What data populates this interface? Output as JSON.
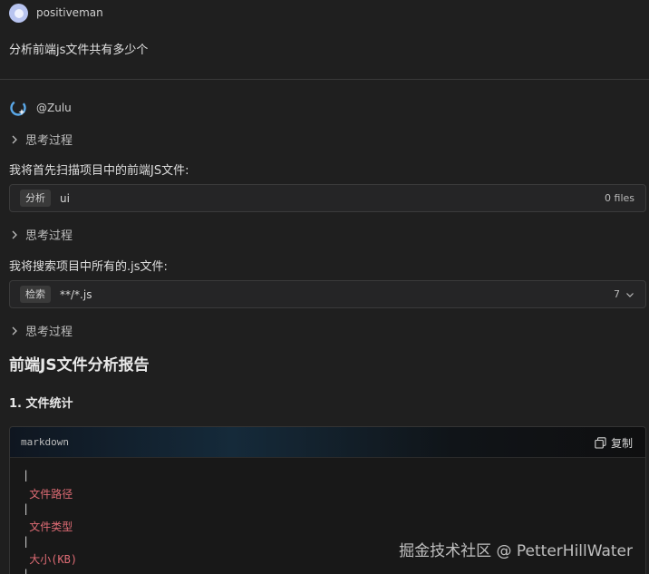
{
  "user": {
    "name": "positiveman",
    "message": "分析前端js文件共有多少个"
  },
  "assistant": {
    "name": "@Zulu"
  },
  "thinking_label": "思考过程",
  "steps": [
    {
      "text": "我将首先扫描项目中的前端JS文件:",
      "tool": {
        "tag": "分析",
        "arg": "ui",
        "result": "0 files"
      }
    },
    {
      "text": "我将搜索项目中所有的.js文件:",
      "tool": {
        "tag": "检索",
        "arg": "**/*.js",
        "result": "7"
      }
    }
  ],
  "report": {
    "title": "前端JS文件分析报告",
    "section1": "1. 文件统计"
  },
  "code": {
    "lang": "markdown",
    "copy_label": "复制",
    "lines": [
      "|",
      " 文件路径",
      "|",
      " 文件类型",
      "|",
      " 大小(KB)",
      "|"
    ]
  },
  "watermark": "掘金技术社区 @ PetterHillWater",
  "colors": {
    "background": "#1f1f1f",
    "tool_box": "#252526",
    "code_string": "#e06c75",
    "avatar": "#b8c4f0",
    "bot_icon": "#5aa8e8"
  },
  "icons": {
    "thinking": "chevron-right-icon",
    "copy": "copy-icon",
    "dropdown": "chevron-down-icon",
    "bot": "zulu-logo-icon"
  }
}
